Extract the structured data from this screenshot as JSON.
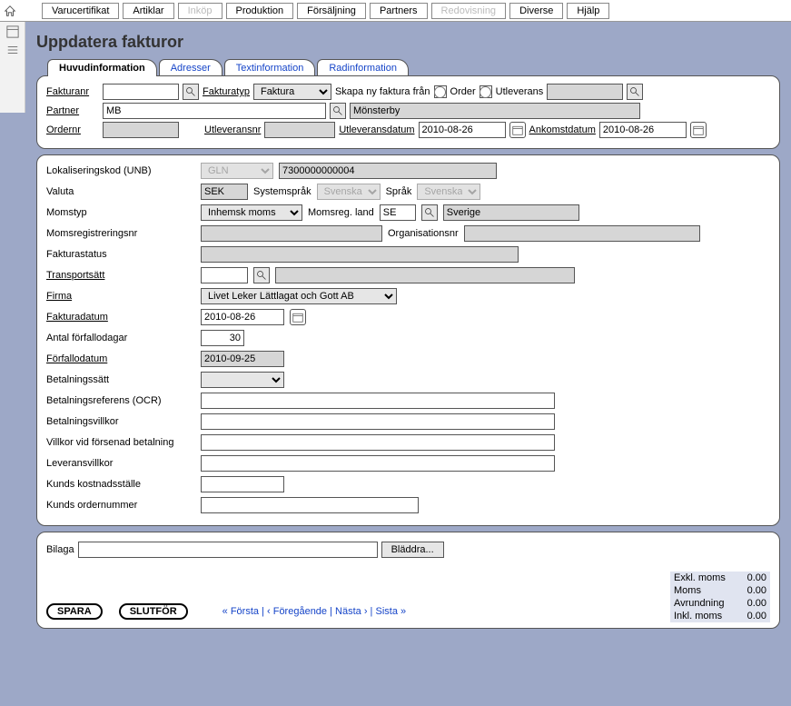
{
  "nav": {
    "items": [
      "Varucertifikat",
      "Artiklar",
      "Inköp",
      "Produktion",
      "Försäljning",
      "Partners",
      "Redovisning",
      "Diverse",
      "Hjälp"
    ],
    "disabled": [
      2,
      6
    ]
  },
  "page": {
    "title": "Uppdatera fakturor"
  },
  "tabs": [
    "Huvudinformation",
    "Adresser",
    "Textinformation",
    "Radinformation"
  ],
  "head": {
    "fakturanr_lbl": "Fakturanr",
    "fakturatyp_lbl": "Fakturatyp",
    "fakturatyp_val": "Faktura",
    "skapa_lbl": "Skapa ny faktura från",
    "order_lbl": "Order",
    "utleverans_lbl": "Utleverans",
    "partner_lbl": "Partner",
    "partner_code": "MB",
    "partner_name": "Mönsterby",
    "ordernr_lbl": "Ordernr",
    "utleveransnr_lbl": "Utleveransnr",
    "utleveransdatum_lbl": "Utleveransdatum",
    "utleveransdatum_val": "2010-08-26",
    "ankomstdatum_lbl": "Ankomstdatum",
    "ankomstdatum_val": "2010-08-26"
  },
  "form": {
    "lokal_lbl": "Lokaliseringskod (UNB)",
    "lokal_type": "GLN",
    "lokal_val": "7300000000004",
    "valuta_lbl": "Valuta",
    "valuta_val": "SEK",
    "systemsprak_lbl": "Systemspråk",
    "systemsprak_val": "Svenska",
    "sprak_lbl": "Språk",
    "sprak_val": "Svenska",
    "momstyp_lbl": "Momstyp",
    "momstyp_val": "Inhemsk moms",
    "momsreg_lbl": "Momsreg. land",
    "momsreg_code": "SE",
    "momsreg_name": "Sverige",
    "momsregnr_lbl": "Momsregistreringsnr",
    "orgnr_lbl": "Organisationsnr",
    "fakturastatus_lbl": "Fakturastatus",
    "transport_lbl": "Transportsätt",
    "firma_lbl": "Firma",
    "firma_val": "Livet Leker Lättlagat och Gott AB",
    "fakturadatum_lbl": "Fakturadatum",
    "fakturadatum_val": "2010-08-26",
    "antal_lbl": "Antal förfallodagar",
    "antal_val": "30",
    "forfallo_lbl": "Förfallodatum",
    "forfallo_val": "2010-09-25",
    "betalsatt_lbl": "Betalningssätt",
    "ocr_lbl": "Betalningsreferens (OCR)",
    "betalvillkor_lbl": "Betalningsvillkor",
    "forsenad_lbl": "Villkor vid försenad betalning",
    "levvillkor_lbl": "Leveransvillkor",
    "kostnad_lbl": "Kunds kostnadsställe",
    "ordernum_lbl": "Kunds ordernummer"
  },
  "footer": {
    "bilaga_lbl": "Bilaga",
    "browse_lbl": "Bläddra...",
    "spara": "SPARA",
    "slutfor": "SLUTFÖR",
    "pager_first": "« Första",
    "pager_prev": "‹ Föregående",
    "pager_next": "Nästa ›",
    "pager_last": "Sista »",
    "totals": [
      {
        "lbl": "Exkl. moms",
        "val": "0.00"
      },
      {
        "lbl": "Moms",
        "val": "0.00"
      },
      {
        "lbl": "Avrundning",
        "val": "0.00"
      },
      {
        "lbl": "Inkl. moms",
        "val": "0.00"
      }
    ]
  }
}
